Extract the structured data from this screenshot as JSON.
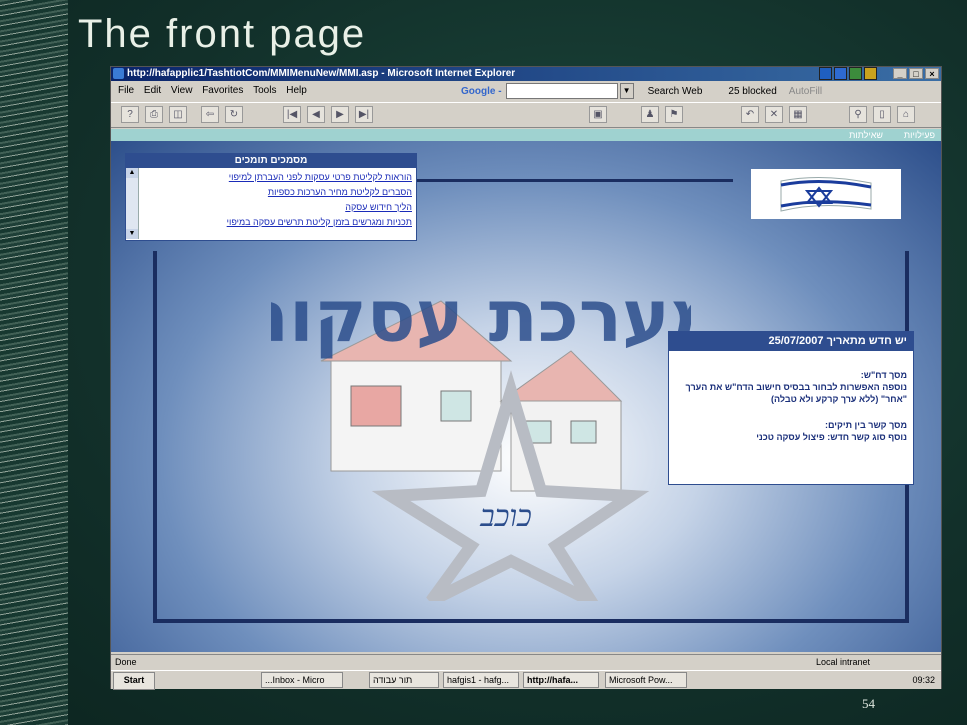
{
  "slide": {
    "title": "The front page",
    "page_number": "54"
  },
  "browser": {
    "title": "http://hafapplic1/TashtiotCom/MMIMenuNew/MMI.asp - Microsoft Internet Explorer",
    "menus": [
      "File",
      "Edit",
      "View",
      "Favorites",
      "Tools",
      "Help"
    ],
    "google_label": "Google -",
    "search_web": "Search Web",
    "blocked": "25 blocked",
    "autofill": "AutoFill",
    "status_text": "Done",
    "status_zone": "Local intranet"
  },
  "site": {
    "nav_links": [
      "פעילויות",
      "שאילתות"
    ],
    "docs_panel": {
      "title": "מסמכים תומכים",
      "links": [
        "הוראות לקליטת פרטי עסקות לפני העברתן למיפוי",
        "הסברים לקליטת מחיר הערכות כספיות",
        "הליך חידוש עסקה",
        "תכניות ומגרשים בזמן קליטת תרשים עסקה במיפוי"
      ]
    },
    "logo_text": "מערכת עסקות",
    "logo_sub": "כוכב",
    "news_panel": {
      "title": "יש חדש מתאריך 25/07/2007",
      "section1_title": "מסך דח\"ש:",
      "section1_body": "נוספה האפשרות לבחור בבסיס חישוב הדח\"ש את הערך \"אחר\" (ללא ערך קרקע ולא טבלה)",
      "section2_title": "מסך קשר בין תיקים:",
      "section2_body": "נוסף סוג קשר חדש: פיצול עסקה טכני"
    }
  },
  "taskbar": {
    "start": "Start",
    "tasks": [
      "...Inbox - Micro",
      "תור עבודה",
      "hafgis1 - hafg...",
      "http://hafa...",
      "Microsoft Pow..."
    ],
    "clock": "09:32"
  }
}
